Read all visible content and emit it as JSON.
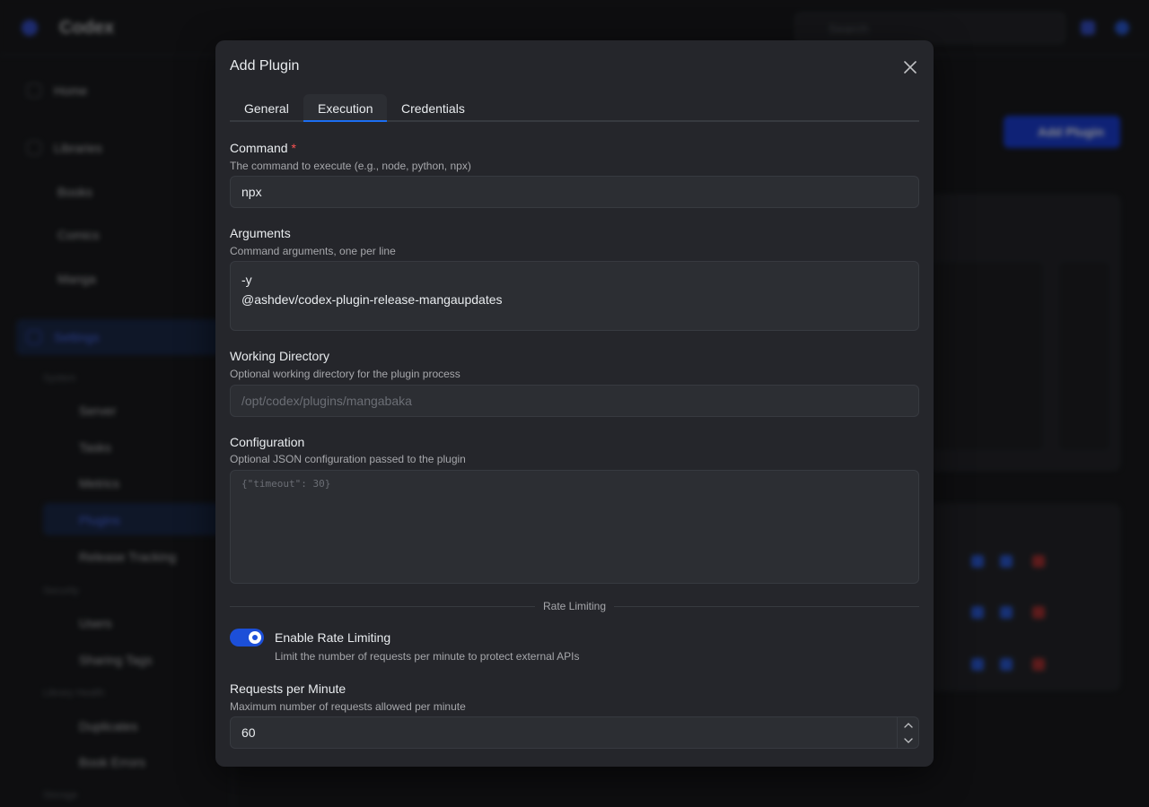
{
  "background": {
    "app_name": "Codex",
    "search_placeholder": "Search",
    "add_button_label": "Add Plugin",
    "sidebar": {
      "top_items": [
        {
          "label": "Home",
          "icon": "home-icon"
        },
        {
          "label": "Libraries",
          "icon": "library-icon"
        }
      ],
      "library_items": [
        "Books",
        "Comics",
        "Manga"
      ],
      "settings_label": "Settings",
      "sections": [
        {
          "title": "System",
          "items": [
            "Server",
            "Tasks",
            "Metrics",
            "Plugins",
            "Release Tracking"
          ]
        },
        {
          "title": "Security",
          "items": [
            "Users",
            "Sharing Tags"
          ]
        },
        {
          "title": "Library Health",
          "items": [
            "Duplicates",
            "Book Errors"
          ]
        },
        {
          "title": "Storage",
          "items": []
        }
      ],
      "active_item": "Plugins"
    }
  },
  "modal": {
    "title": "Add Plugin",
    "close_icon": "close-icon",
    "tabs": [
      {
        "label": "General",
        "active": false
      },
      {
        "label": "Execution",
        "active": true
      },
      {
        "label": "Credentials",
        "active": false
      }
    ],
    "command": {
      "label": "Command",
      "required_mark": "*",
      "description": "The command to execute (e.g., node, python, npx)",
      "value": "npx"
    },
    "arguments": {
      "label": "Arguments",
      "description": "Command arguments, one per line",
      "value": "-y\n@ashdev/codex-plugin-release-mangaupdates"
    },
    "working_directory": {
      "label": "Working Directory",
      "description": "Optional working directory for the plugin process",
      "placeholder": "/opt/codex/plugins/mangabaka",
      "value": ""
    },
    "configuration": {
      "label": "Configuration",
      "description": "Optional JSON configuration passed to the plugin",
      "placeholder": "{\"timeout\": 30}",
      "value": ""
    },
    "rate_limiting": {
      "divider_label": "Rate Limiting",
      "toggle_label": "Enable Rate Limiting",
      "toggle_description": "Limit the number of requests per minute to protect external APIs",
      "enabled": true
    },
    "requests_per_minute": {
      "label": "Requests per Minute",
      "description": "Maximum number of requests allowed per minute",
      "value": "60"
    }
  },
  "colors": {
    "accent": "#1c4fd8",
    "modal_bg": "#25262b",
    "input_bg": "#2c2e33",
    "required": "#fa5252"
  }
}
